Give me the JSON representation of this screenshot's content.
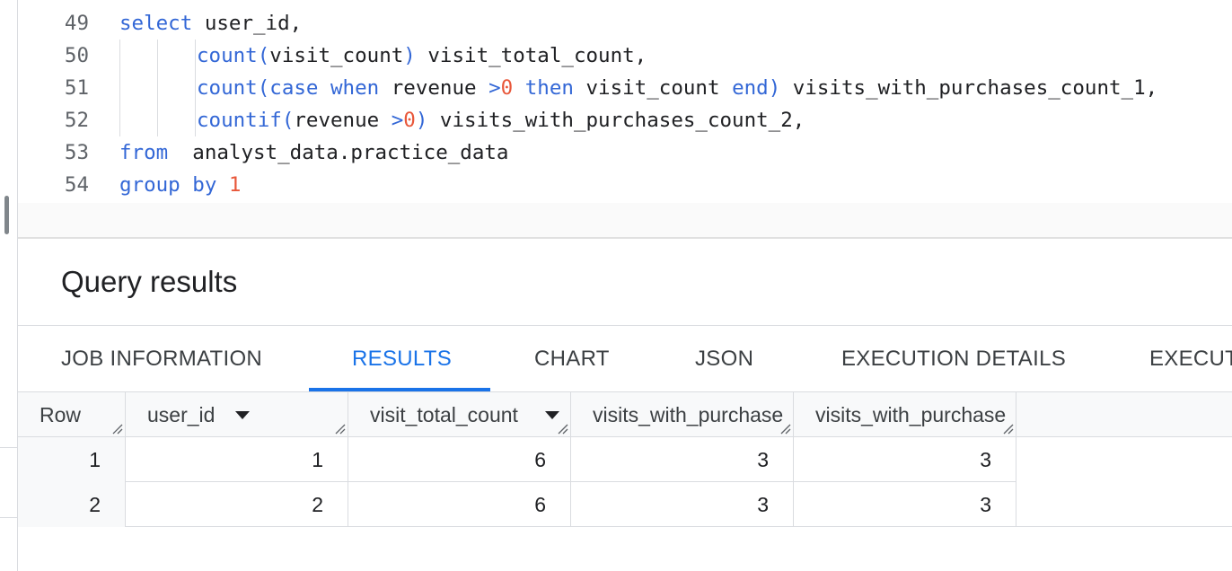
{
  "editor": {
    "lines": [
      {
        "no": "49",
        "segments": [
          {
            "t": "select",
            "c": "kw"
          },
          {
            "t": " user_id,",
            "c": ""
          }
        ]
      },
      {
        "no": "50",
        "segments": [
          {
            "t": "count(",
            "c": "kw"
          },
          {
            "t": "visit_count",
            "c": ""
          },
          {
            "t": ")",
            "c": "kw"
          },
          {
            "t": " visit_total_count,",
            "c": ""
          }
        ]
      },
      {
        "no": "51",
        "segments": [
          {
            "t": "count(case when",
            "c": "kw"
          },
          {
            "t": " revenue ",
            "c": ""
          },
          {
            "t": ">",
            "c": "kw"
          },
          {
            "t": "0",
            "c": "num"
          },
          {
            "t": " then",
            "c": "kw"
          },
          {
            "t": " visit_count ",
            "c": ""
          },
          {
            "t": "end)",
            "c": "kw"
          },
          {
            "t": " visits_with_purchases_count_1,",
            "c": ""
          }
        ]
      },
      {
        "no": "52",
        "segments": [
          {
            "t": "countif(",
            "c": "kw"
          },
          {
            "t": "revenue ",
            "c": ""
          },
          {
            "t": ">",
            "c": "kw"
          },
          {
            "t": "0",
            "c": "num"
          },
          {
            "t": ")",
            "c": "kw"
          },
          {
            "t": " visits_with_purchases_count_2,",
            "c": ""
          }
        ]
      },
      {
        "no": "53",
        "segments": [
          {
            "t": "from",
            "c": "kw"
          },
          {
            "t": "  analyst_data.practice_data",
            "c": ""
          }
        ]
      },
      {
        "no": "54",
        "segments": [
          {
            "t": "group by",
            "c": "kw"
          },
          {
            "t": " ",
            "c": ""
          },
          {
            "t": "1",
            "c": "num"
          }
        ]
      }
    ]
  },
  "results": {
    "title": "Query results",
    "tabs": [
      {
        "label": "JOB INFORMATION",
        "active": false
      },
      {
        "label": "RESULTS",
        "active": true
      },
      {
        "label": "CHART",
        "active": false
      },
      {
        "label": "JSON",
        "active": false
      },
      {
        "label": "EXECUTION DETAILS",
        "active": false
      },
      {
        "label": "EXECUT",
        "active": false
      }
    ],
    "columns": [
      {
        "label": "Row",
        "sortable": false
      },
      {
        "label": "user_id",
        "sortable": true
      },
      {
        "label": "visit_total_count",
        "sortable": true
      },
      {
        "label": "visits_with_purchase",
        "sortable": false
      },
      {
        "label": "visits_with_purchase",
        "sortable": false
      }
    ],
    "rows": [
      [
        "1",
        "1",
        "6",
        "3",
        "3"
      ],
      [
        "2",
        "2",
        "6",
        "3",
        "3"
      ]
    ]
  },
  "colors": {
    "keyword": "#3367d6",
    "number": "#e8573a",
    "active_tab": "#1a73e8"
  },
  "icons": {
    "sort": "caret-down-icon",
    "resize": "resize-handle-icon"
  }
}
